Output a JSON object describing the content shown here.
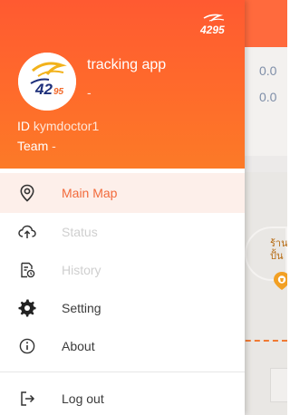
{
  "colors": {
    "accent": "#ff6a3d",
    "active_text": "#f26a3b",
    "active_bg": "#fdefea",
    "disabled_text": "#cfcfcf"
  },
  "drawer": {
    "app_name": "tracking app",
    "app_subtitle": "-",
    "user_id_label": "ID",
    "user_id_value": "kymdoctor1",
    "team_label": "Team",
    "team_value": "-",
    "logo_text": "4295",
    "menu": [
      {
        "label": "Main Map",
        "icon": "location-pin-icon",
        "state": "active"
      },
      {
        "label": "Status",
        "icon": "cloud-upload-icon",
        "state": "disabled"
      },
      {
        "label": "History",
        "icon": "history-document-icon",
        "state": "disabled"
      },
      {
        "label": "Setting",
        "icon": "gear-icon",
        "state": "normal"
      },
      {
        "label": "About",
        "icon": "info-icon",
        "state": "normal"
      },
      {
        "label": "Log out",
        "icon": "logout-icon",
        "state": "normal"
      }
    ]
  },
  "background": {
    "value_1": "0.0",
    "value_2": "0.0",
    "place_label": "ร้าน\nปั้น"
  }
}
